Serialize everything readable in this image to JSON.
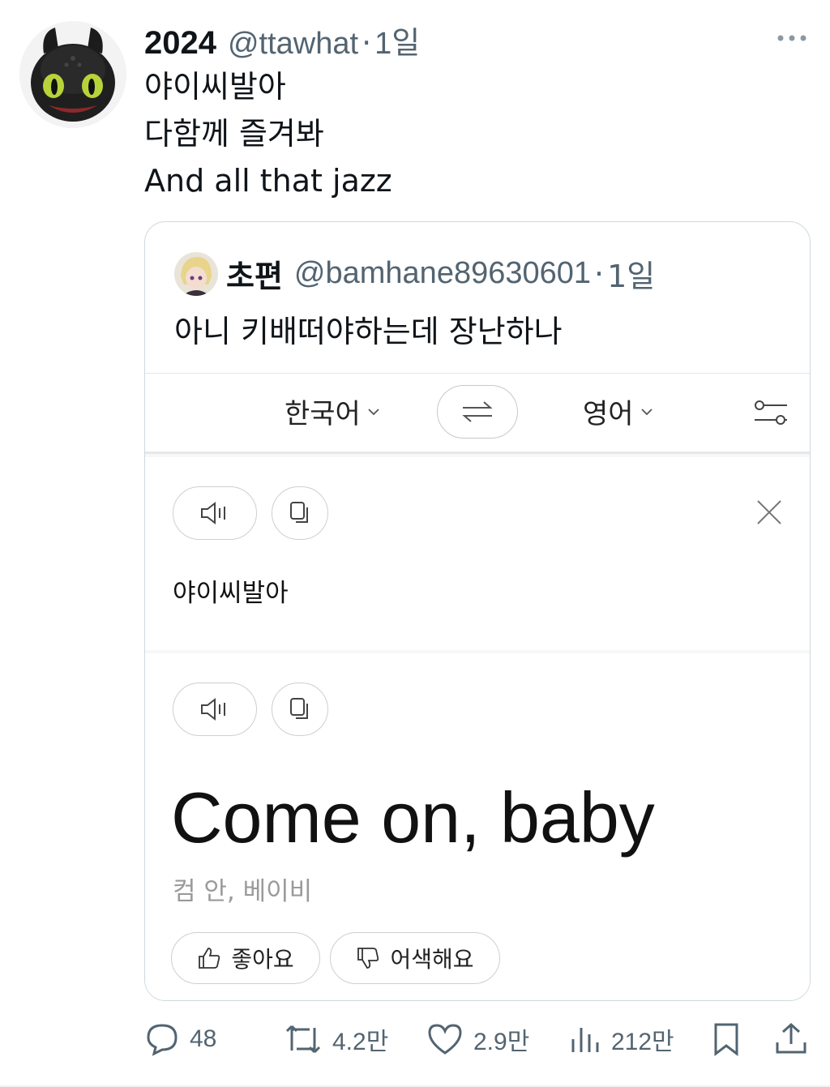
{
  "tweet": {
    "display_name": "2024",
    "handle": "@ttawhat",
    "separator": "·",
    "time": "1일",
    "avatar_icon": "dragon-avatar-icon",
    "lines": [
      "야이씨발아",
      "다함께 즐겨봐",
      "And all that jazz"
    ]
  },
  "quote": {
    "display_name": "초편",
    "handle": "@bamhane89630601",
    "separator": "·",
    "time": "1일",
    "avatar_icon": "anime-character-avatar-icon",
    "text": "아니 키배떠야하는데 장난하나"
  },
  "translator": {
    "source_lang": "한국어",
    "target_lang": "영어",
    "source_text": "야이씨발아",
    "translated_text": "Come on, baby",
    "pronunciation": "컴 안, 베이비",
    "like_label": "좋아요",
    "dislike_label": "어색해요"
  },
  "actions": {
    "replies": "48",
    "retweets": "4.2만",
    "likes": "2.9만",
    "views": "212만"
  },
  "colors": {
    "text_primary": "#0f1419",
    "text_secondary": "#536471",
    "border": "#cfd9de"
  }
}
